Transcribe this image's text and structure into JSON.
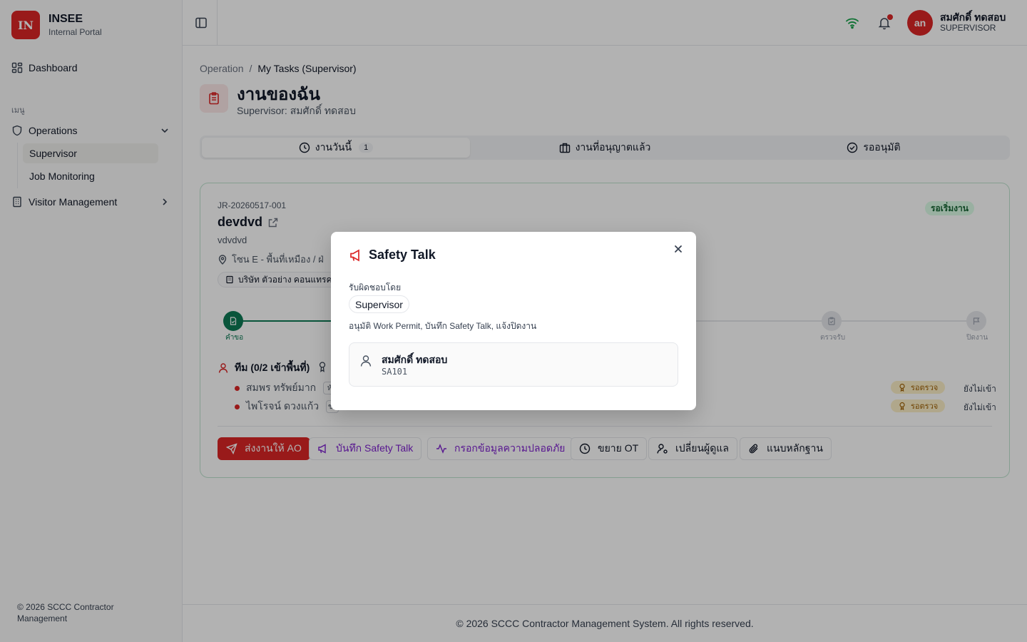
{
  "sidebar": {
    "logo_text": "IN",
    "brand_name": "INSEE",
    "brand_sub": "Internal Portal",
    "dashboard": "Dashboard",
    "group_label": "เมนู",
    "operations": "Operations",
    "sub_items": [
      "Supervisor",
      "Job Monitoring"
    ],
    "visitor": "Visitor Management",
    "footer": "© 2026 SCCC Contractor Management"
  },
  "topbar": {
    "avatar_initials": "an",
    "user_name": "สมศักดิ์ ทดสอบ",
    "user_role": "SUPERVISOR"
  },
  "breadcrumb": [
    "Operation",
    "My Tasks (Supervisor)"
  ],
  "page": {
    "title": "งานของฉัน",
    "subtitle": "Supervisor: สมศักดิ์ ทดสอบ"
  },
  "tabs": [
    {
      "label": "งานวันนี้",
      "count": "1"
    },
    {
      "label": "งานที่อนุญาตแล้ว"
    },
    {
      "label": "รออนุมัติ"
    }
  ],
  "job": {
    "number": "JR-20260517-001",
    "title": "devdvd",
    "description": "vdvdvd",
    "location": "โซน E - พื้นที่เหมือง  /  ฝ่",
    "company": "บริษัท ตัวอย่าง คอนแทรคติ้",
    "status": "รอเริ่มงาน",
    "steps": [
      "คำขอ",
      "ตรวจรับ",
      "ปิดงาน"
    ],
    "team_title": "ทีม (0/2 เข้าพื้นที่)",
    "members": [
      {
        "name": "สมพร ทรัพย์มาก",
        "role": "หั",
        "check": "รอตรวจ",
        "state": "ยังไม่เข้า"
      },
      {
        "name": "ไพโรจน์ ดวงแก้ว",
        "role": "ช่า",
        "check": "รอตรวจ",
        "state": "ยังไม่เข้า"
      }
    ]
  },
  "actions": [
    "ส่งงานให้ AO",
    "บันทึก Safety Talk",
    "กรอกข้อมูลความปลอดภัย",
    "ขยาย OT",
    "เปลี่ยนผู้ดูแล",
    "แนบหลักฐาน"
  ],
  "footer": "© 2026 SCCC Contractor Management System. All rights reserved.",
  "modal": {
    "title": "Safety Talk",
    "responsible_label": "รับผิดชอบโดย",
    "role_chip": "Supervisor",
    "description": "อนุมัติ Work Permit, บันทึก Safety Talk, แจ้งปิดงาน",
    "person_name": "สมศักดิ์ ทดสอบ",
    "person_code": "SA101"
  },
  "colors": {
    "brand": "#dc2626",
    "success": "#0d7a55",
    "purple": "#7e22ce",
    "wifi": "#16a34a"
  }
}
